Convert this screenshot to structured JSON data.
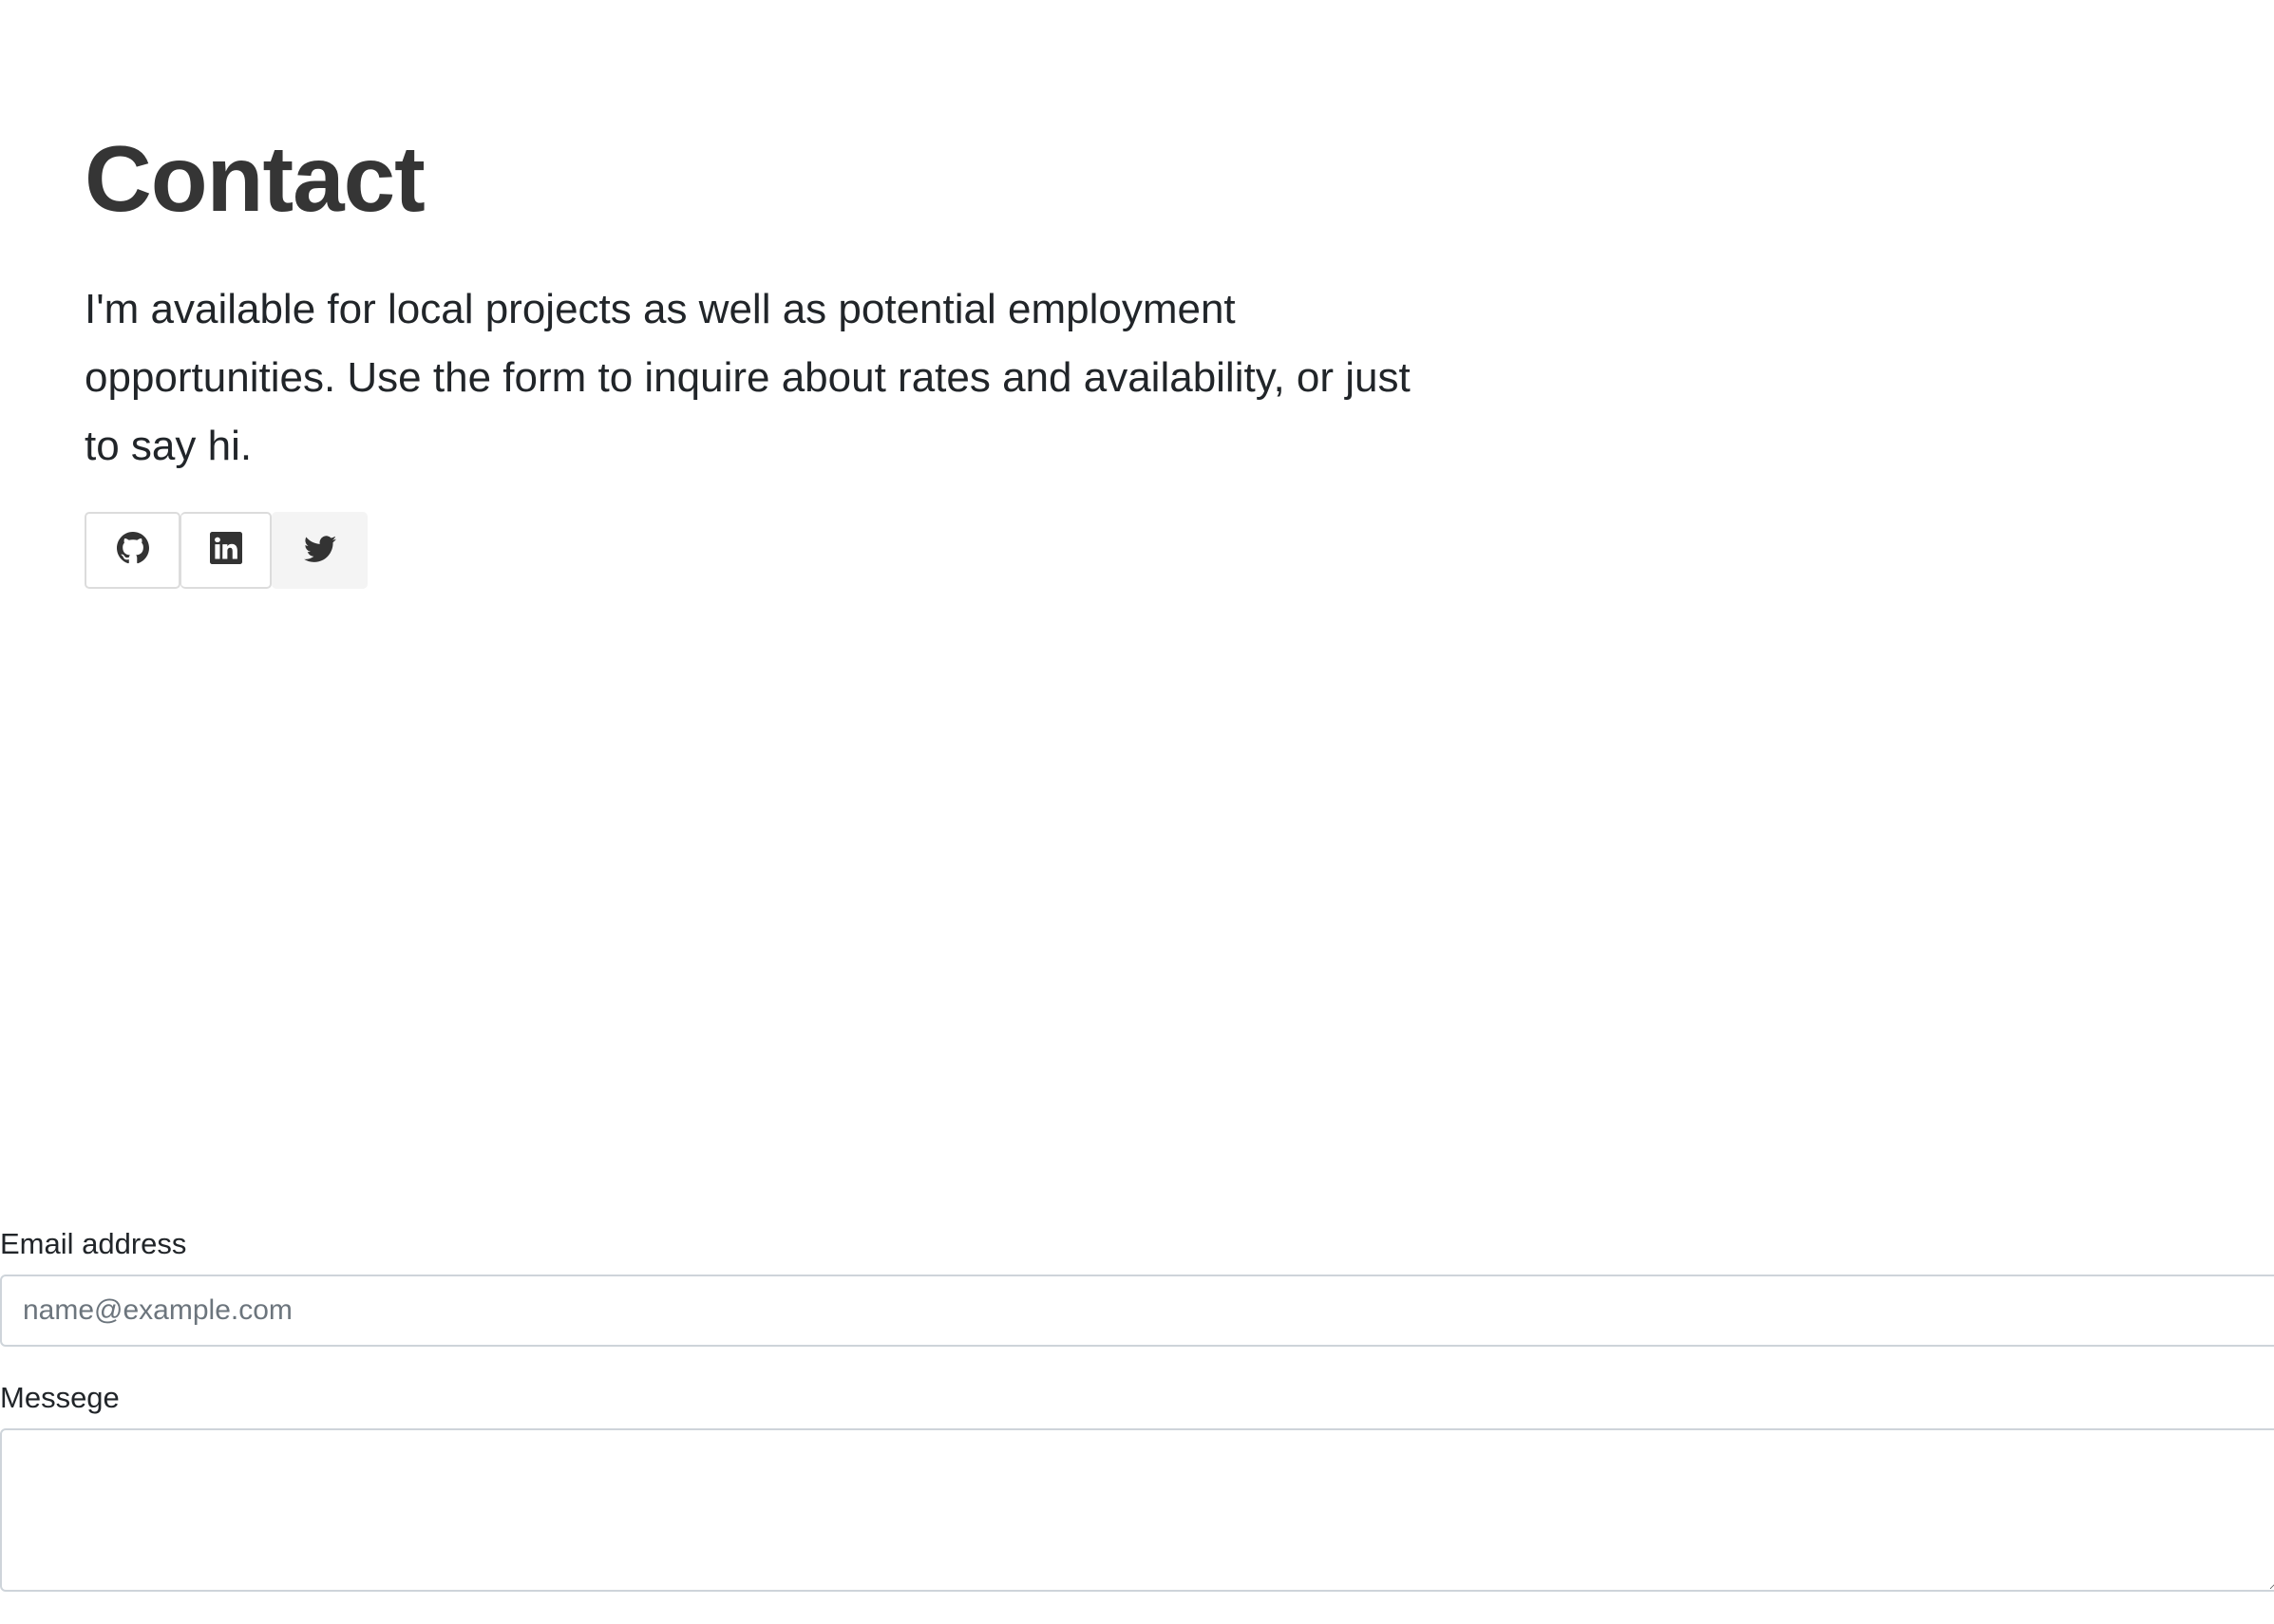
{
  "contact": {
    "title": "Contact",
    "intro": "I'm available for local projects as well as potential employment opportunities. Use the form to inquire about rates and availability, or just to say hi."
  },
  "socials": [
    {
      "icon": "github-icon"
    },
    {
      "icon": "linkedin-icon"
    },
    {
      "icon": "twitter-icon"
    }
  ],
  "form": {
    "email_label": "Email address",
    "email_placeholder": "name@example.com",
    "email_value": "",
    "message_label": "Messege",
    "message_value": ""
  },
  "colors": {
    "heading": "#353535",
    "text": "#212529",
    "border": "#ced4da",
    "placeholder": "#6c757d",
    "twitter_button_bg": "#f4f4f4"
  }
}
